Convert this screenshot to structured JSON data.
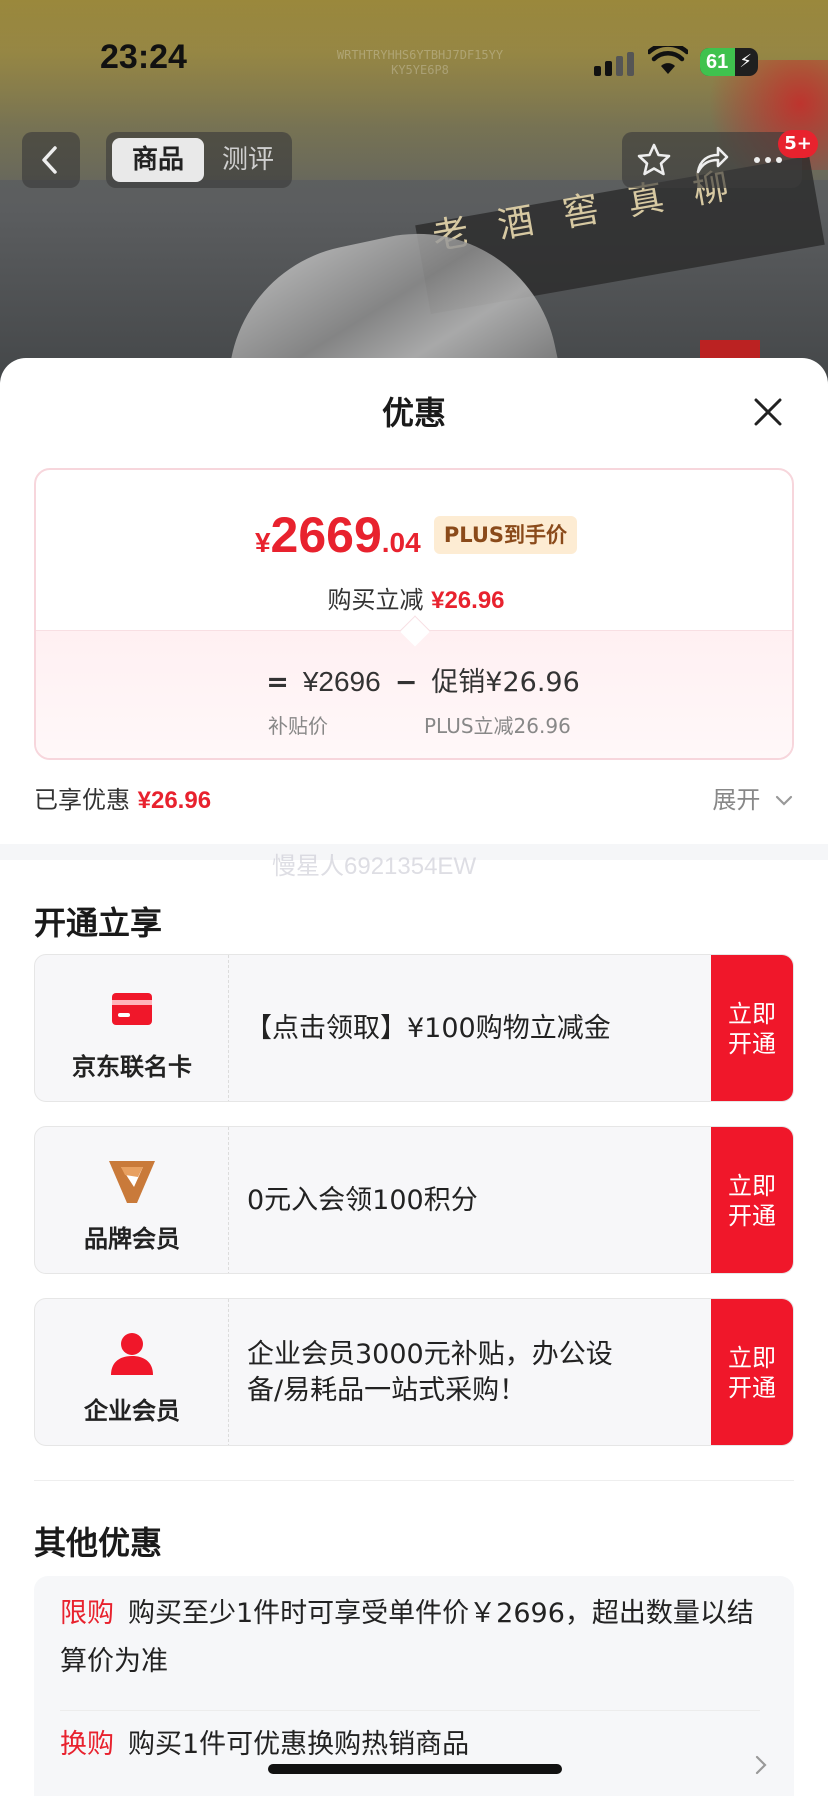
{
  "status_bar": {
    "time": "23:24",
    "battery": "61",
    "battery_level": 0.61
  },
  "watermark_top": [
    "WRTHTRYHHS6YTBHJ7DF15YY",
    "KY5YE6P8"
  ],
  "nav": {
    "tabs": [
      {
        "label": "商品",
        "active": true
      },
      {
        "label": "测评",
        "active": false
      }
    ],
    "badge": "5+"
  },
  "background_sign": "老酒窖真柳",
  "sheet": {
    "title": "优惠",
    "price_card": {
      "currency": "¥",
      "price_int": "2669",
      "price_dec": ".04",
      "plus_tag": "PLUS到手价",
      "reduce_label": "购买立减",
      "reduce_value": "¥26.96",
      "formula": {
        "eq": "=",
        "base": "¥2696",
        "minus": "−",
        "promo": "促销¥26.96",
        "base_label": "补贴价",
        "promo_label": "PLUS立减26.96"
      }
    },
    "enjoyed": {
      "label": "已享优惠",
      "value": "¥26.96"
    },
    "expand": "展开",
    "watermark_mid": "慢星人6921354EW",
    "open_section": {
      "title": "开通立享",
      "items": [
        {
          "label": "京东联名卡",
          "icon": "card-icon",
          "text": "【点击领取】¥100购物立减金",
          "button": "立即开通"
        },
        {
          "label": "品牌会员",
          "icon": "brand-v-icon",
          "text": "0元入会领100积分",
          "button": "立即开通"
        },
        {
          "label": "企业会员",
          "icon": "person-icon",
          "text": "企业会员3000元补贴，办公设备/易耗品一站式采购！",
          "button": "立即开通"
        }
      ]
    },
    "other_section": {
      "title": "其他优惠",
      "items": [
        {
          "tag": "限购",
          "text": "购买至少1件时可享受单件价￥2696，超出数量以结算价为准"
        },
        {
          "tag": "换购",
          "text": "购买1件可优惠换购热销商品"
        }
      ]
    }
  },
  "colors": {
    "accent": "#e8222e",
    "button": "#f0172a",
    "plus_tag_bg": "#fdecd3"
  }
}
